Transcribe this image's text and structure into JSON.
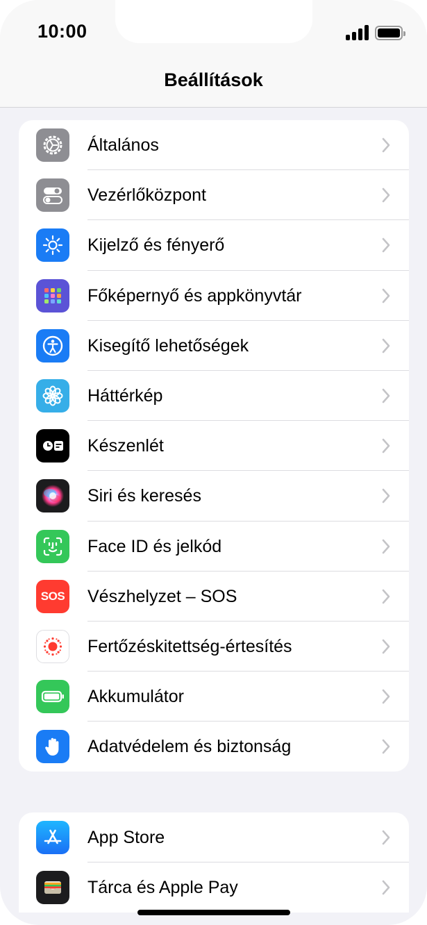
{
  "status_bar": {
    "time": "10:00"
  },
  "header": {
    "title": "Beállítások"
  },
  "groups": [
    {
      "items": [
        {
          "label": "Általános",
          "icon": "gear-icon",
          "color": "#8e8e93"
        },
        {
          "label": "Vezérlőközpont",
          "icon": "toggles-icon",
          "color": "#8e8e93"
        },
        {
          "label": "Kijelző és fényerő",
          "icon": "sun-icon",
          "color": "#1a7cf5"
        },
        {
          "label": "Főképernyő és appkönyvtár",
          "icon": "app-grid-icon",
          "color": "#5b53d6"
        },
        {
          "label": "Kisegítő lehetőségek",
          "icon": "accessibility-icon",
          "color": "#1a7cf5"
        },
        {
          "label": "Háttérkép",
          "icon": "flower-icon",
          "color": "#36aee8"
        },
        {
          "label": "Készenlét",
          "icon": "standby-icon",
          "color": "#000000"
        },
        {
          "label": "Siri és keresés",
          "icon": "siri-icon",
          "color": "#1c1c1e"
        },
        {
          "label": "Face ID és jelkód",
          "icon": "face-id-icon",
          "color": "#34c759"
        },
        {
          "label": "Vészhelyzet – SOS",
          "icon": "sos-icon",
          "icon_text": "SOS",
          "color": "#ff3b30"
        },
        {
          "label": "Fertőzéskitettség-értesítés",
          "icon": "exposure-icon",
          "color": "#ffffff"
        },
        {
          "label": "Akkumulátor",
          "icon": "battery-icon",
          "color": "#34c759"
        },
        {
          "label": "Adatvédelem és biztonság",
          "icon": "hand-icon",
          "color": "#1a7cf5"
        }
      ]
    },
    {
      "items": [
        {
          "label": "App Store",
          "icon": "app-store-icon",
          "color": "#1a8cf7"
        },
        {
          "label": "Tárca és Apple Pay",
          "icon": "wallet-icon",
          "color": "#1c1c1e"
        }
      ]
    }
  ]
}
